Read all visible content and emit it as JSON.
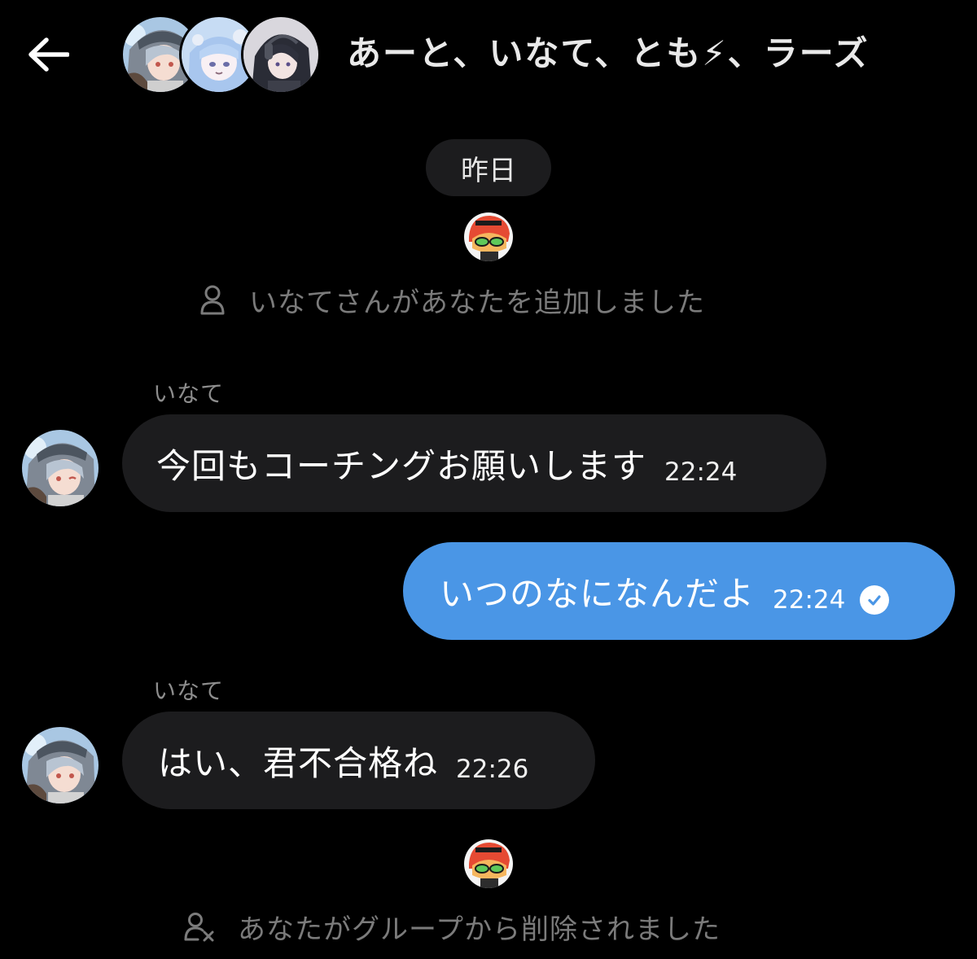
{
  "header": {
    "title": "あーと、いなて、とも⚡、ラーズ",
    "back_icon": "arrow-left-icon",
    "avatars": [
      "avatar-a",
      "avatar-b",
      "avatar-c"
    ]
  },
  "date_divider": "昨日",
  "events": {
    "added": {
      "icon": "person-icon",
      "text": "いなてさんがあなたを追加しました"
    },
    "removed": {
      "icon": "person-remove-icon",
      "text": "あなたがグループから削除されました"
    }
  },
  "messages": [
    {
      "sender": "いなて",
      "text": "今回もコーチングお願いします",
      "time": "22:24"
    },
    {
      "text": "いつのなになんだよ",
      "time": "22:24",
      "status_icon": "read-check-icon"
    },
    {
      "sender": "いなて",
      "text": "はい、君不合格ね",
      "time": "22:26"
    }
  ],
  "colors": {
    "background": "#000000",
    "incoming_bubble": "#1c1c1e",
    "outgoing_bubble": "#4a96e6",
    "muted_text": "#7b7b7b"
  }
}
